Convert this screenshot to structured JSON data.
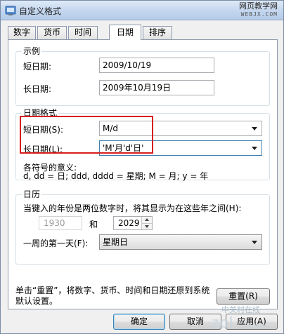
{
  "window": {
    "title": "自定义格式",
    "site_mark_line1": "网页教学网",
    "site_mark_line2": "WEBJX.COM"
  },
  "tabs": [
    {
      "label": "数字",
      "active": false
    },
    {
      "label": "货币",
      "active": false
    },
    {
      "label": "时间",
      "active": false
    },
    {
      "label": "日期",
      "active": true
    },
    {
      "label": "排序",
      "active": false
    }
  ],
  "example": {
    "group_title": "示例",
    "short_label": "短日期:",
    "short_value": "2009/10/19",
    "long_label": "长日期:",
    "long_value": "2009年10月19日"
  },
  "date_format": {
    "group_title": "日期格式",
    "short_label": "短日期(S):",
    "short_value": "M/d",
    "long_label": "长日期(L):",
    "long_value": "'M'月'd'日'",
    "meaning_title": "各符号的意义:",
    "meaning_text": "d, dd = 日;  ddd, dddd = 星期;  M = 月;  y = 年",
    "highlight_color": "#d81e1e"
  },
  "calendar": {
    "group_title": "日历",
    "two_digit_text": "当键入的年份是两位数字时，将其显示为在这些年之间(H):",
    "from_year": "1930",
    "and_label": "和",
    "to_year": "2029",
    "first_day_label": "一周的第一天(F):",
    "first_day_value": "星期日"
  },
  "reset": {
    "note": "单击“重置”，将数字、货币、时间和日期还原到系统默认设置。",
    "button_label": "重置(R)"
  },
  "footer": {
    "ok_label": "确定",
    "cancel_label": "取消",
    "apply_label": "应用(A)"
  },
  "watermark": {
    "text": "中关村在线",
    "sub": "zol.com.cn"
  }
}
